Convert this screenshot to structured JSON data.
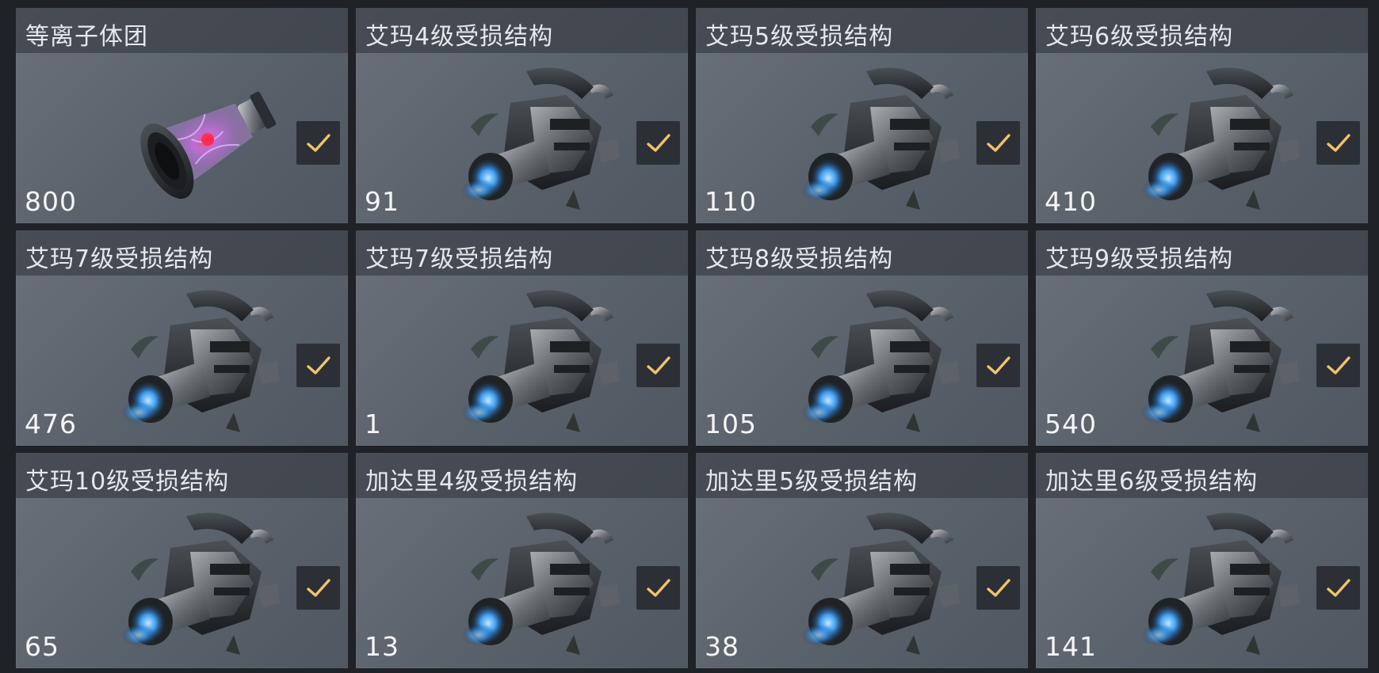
{
  "items": [
    {
      "title": "等离子体团",
      "qty": "800",
      "icon": "plasma-bottle",
      "selected": true
    },
    {
      "title": "艾玛4级受损结构",
      "qty": "91",
      "icon": "damaged-structure",
      "selected": true
    },
    {
      "title": "艾玛5级受损结构",
      "qty": "110",
      "icon": "damaged-structure",
      "selected": true
    },
    {
      "title": "艾玛6级受损结构",
      "qty": "410",
      "icon": "damaged-structure",
      "selected": true
    },
    {
      "title": "艾玛7级受损结构",
      "qty": "476",
      "icon": "damaged-structure",
      "selected": true
    },
    {
      "title": "艾玛7级受损结构",
      "qty": "1",
      "icon": "damaged-structure",
      "selected": true
    },
    {
      "title": "艾玛8级受损结构",
      "qty": "105",
      "icon": "damaged-structure",
      "selected": true
    },
    {
      "title": "艾玛9级受损结构",
      "qty": "540",
      "icon": "damaged-structure",
      "selected": true
    },
    {
      "title": "艾玛10级受损结构",
      "qty": "65",
      "icon": "damaged-structure",
      "selected": true
    },
    {
      "title": "加达里4级受损结构",
      "qty": "13",
      "icon": "damaged-structure",
      "selected": true
    },
    {
      "title": "加达里5级受损结构",
      "qty": "38",
      "icon": "damaged-structure",
      "selected": true
    },
    {
      "title": "加达里6级受损结构",
      "qty": "141",
      "icon": "damaged-structure",
      "selected": true
    }
  ],
  "colors": {
    "check": "#f2c46a",
    "check_bg": "#2c3036",
    "card_bg": "#5f666f",
    "header_bg": "#3a3f46"
  }
}
